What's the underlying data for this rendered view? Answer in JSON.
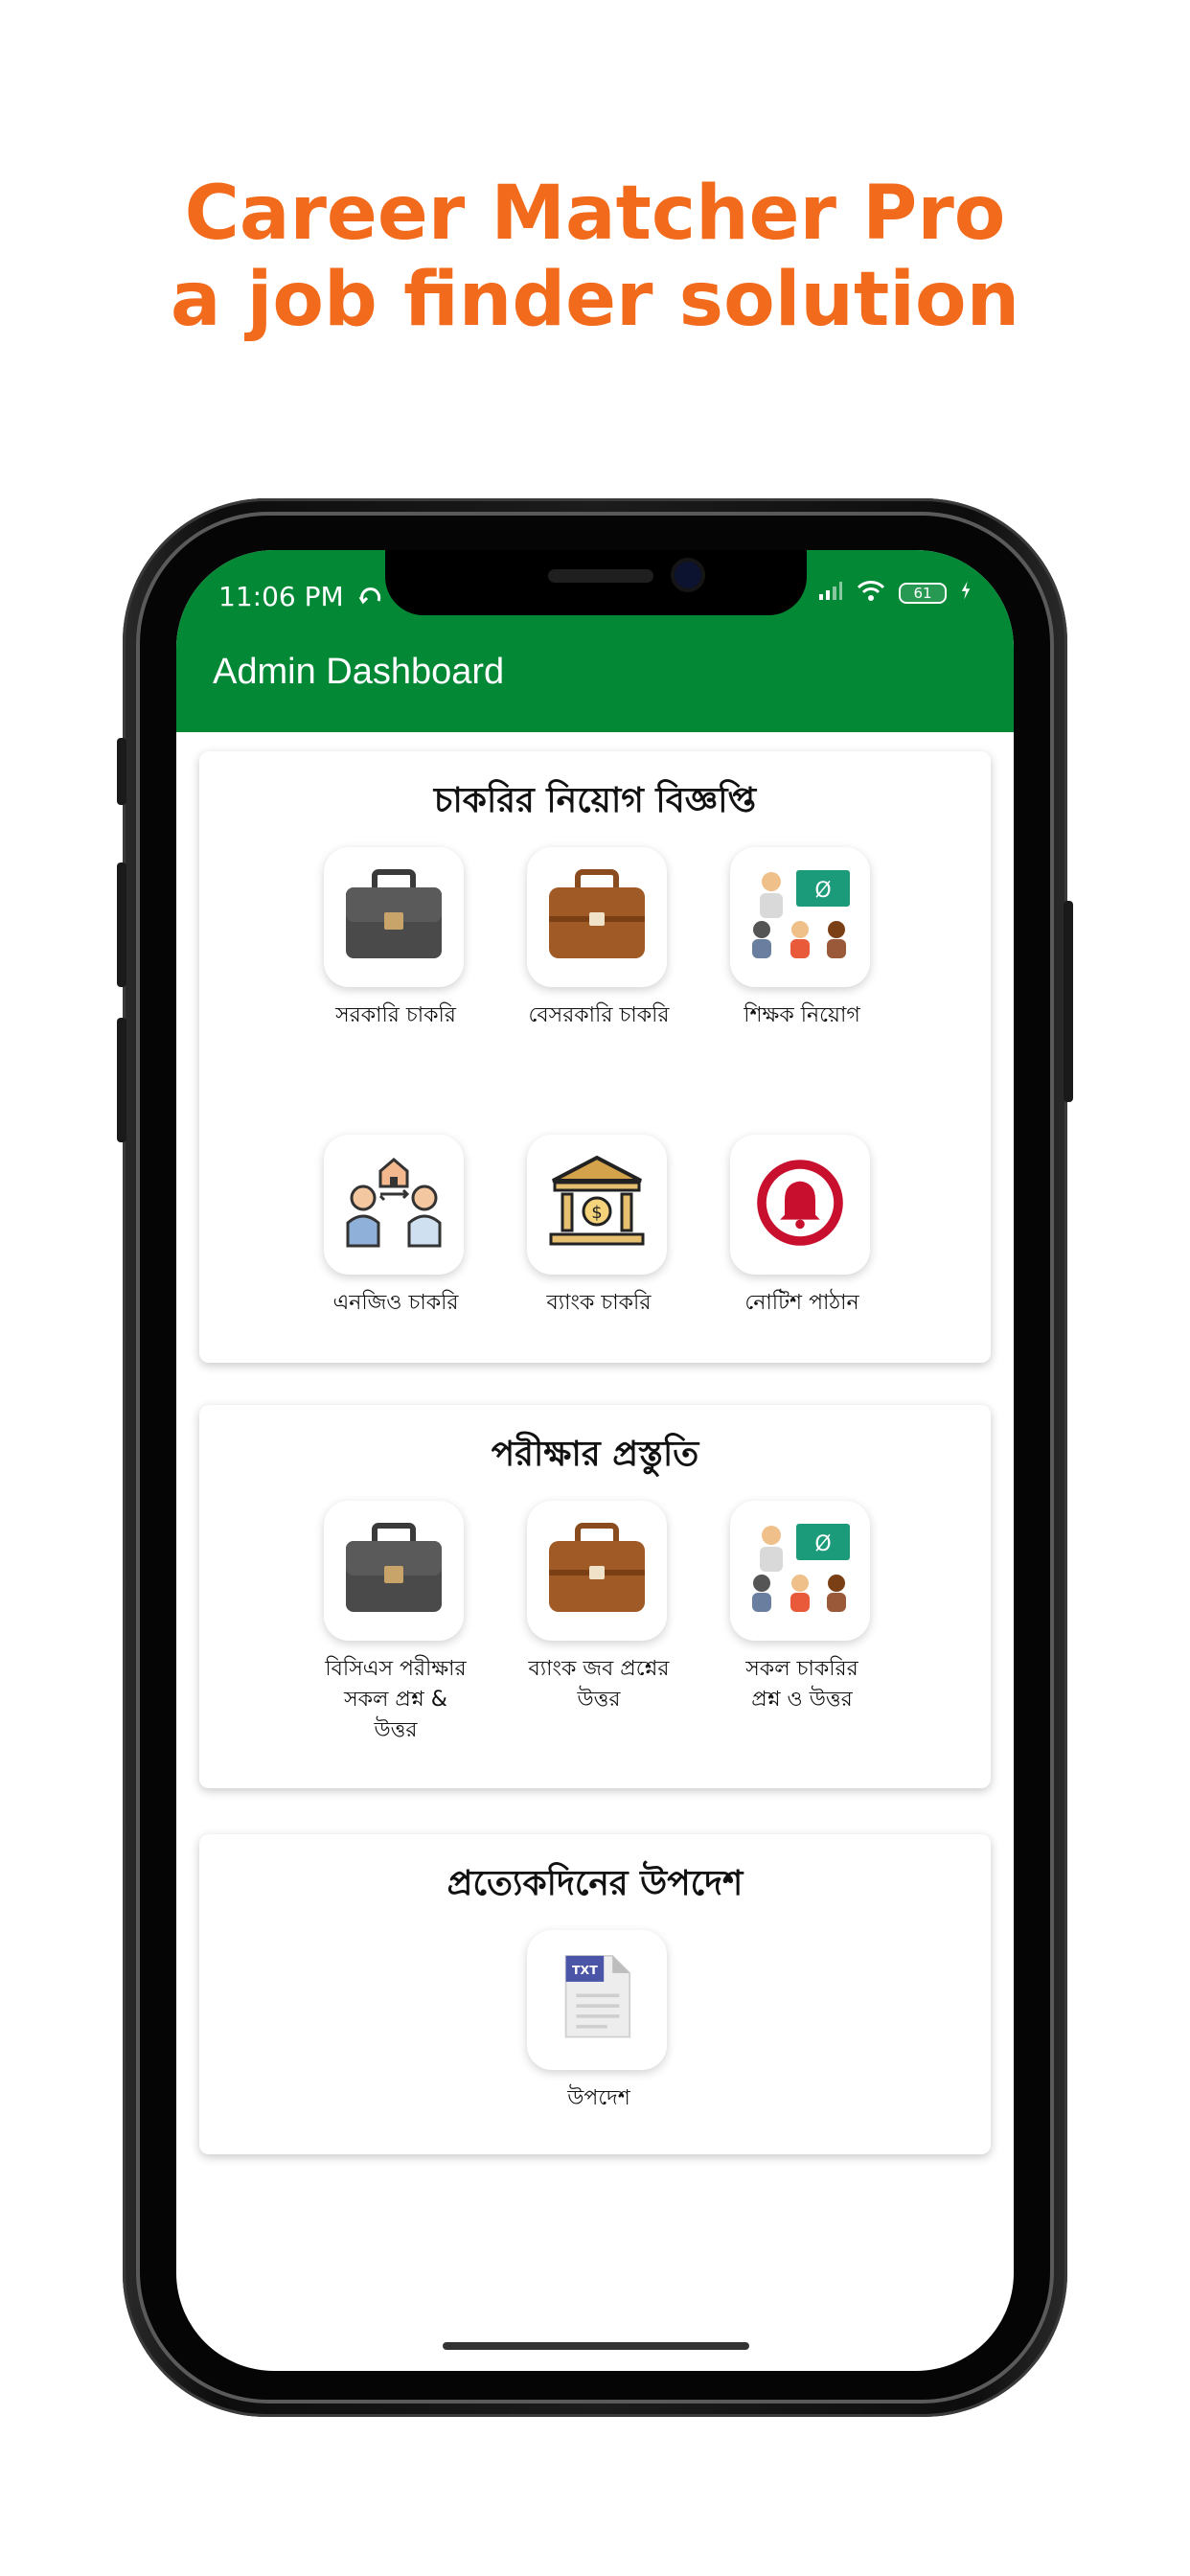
{
  "headline": {
    "line1": "Career Matcher Pro",
    "line2": "a job finder solution"
  },
  "status_bar": {
    "time": "11:06 PM",
    "battery": "61"
  },
  "app_bar": {
    "title": "Admin Dashboard"
  },
  "sections": [
    {
      "title": "চাকরির নিয়োগ বিজ্ঞপ্তি",
      "tiles": [
        {
          "label": "সরকারি চাকরি",
          "icon": "black-briefcase-icon"
        },
        {
          "label": "বেসরকারি চাকরি",
          "icon": "brown-briefcase-icon"
        },
        {
          "label": "শিক্ষক নিয়োগ",
          "icon": "classroom-teacher-icon"
        },
        {
          "label": "এনজিও চাকরি",
          "icon": "ngo-people-icon"
        },
        {
          "label": "ব্যাংক চাকরি",
          "icon": "bank-building-icon"
        },
        {
          "label": "নোটিশ পাঠান",
          "icon": "bell-notification-icon"
        }
      ]
    },
    {
      "title": "পরীক্ষার প্রস্তুতি",
      "tiles": [
        {
          "label": "বিসিএস পরীক্ষার সকল প্রশ্ন & উত্তর",
          "icon": "black-briefcase-icon"
        },
        {
          "label": "ব্যাংক জব প্রশ্নের উত্তর",
          "icon": "brown-briefcase-icon"
        },
        {
          "label": "সকল চাকরির প্রশ্ন ও উত্তর",
          "icon": "classroom-teacher-icon"
        }
      ]
    },
    {
      "title": "প্রত্যেকদিনের উপদেশ",
      "tiles": [
        {
          "label": "উপদেশ",
          "icon": "txt-document-icon"
        }
      ]
    }
  ],
  "colors": {
    "headline": "#f26a1b",
    "app_bar": "#038836"
  }
}
